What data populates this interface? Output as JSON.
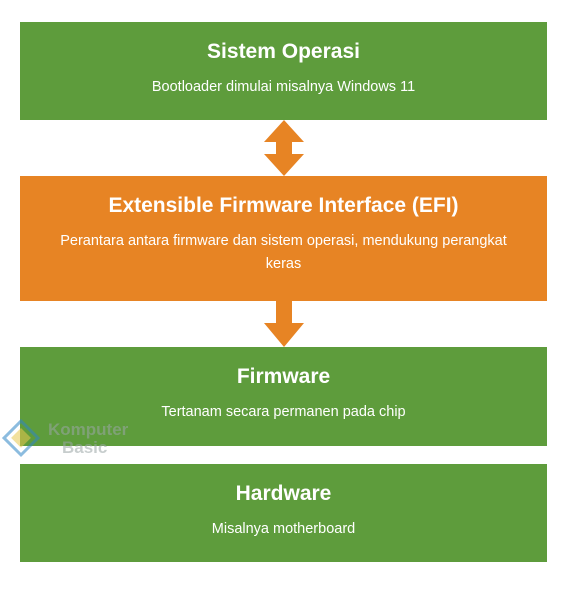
{
  "boxes": {
    "os": {
      "title": "Sistem Operasi",
      "desc": "Bootloader dimulai misalnya Windows 11"
    },
    "efi": {
      "title": "Extensible Firmware Interface (EFI)",
      "desc": "Perantara antara firmware dan sistem operasi, mendukung perangkat keras"
    },
    "firmware": {
      "title": "Firmware",
      "desc": "Tertanam secara permanen pada chip"
    },
    "hardware": {
      "title": "Hardware",
      "desc": "Misalnya motherboard"
    }
  },
  "watermark": {
    "line1": "Komputer",
    "line2": "Basic"
  },
  "colors": {
    "green": "#5e9c3c",
    "orange": "#e78424"
  }
}
